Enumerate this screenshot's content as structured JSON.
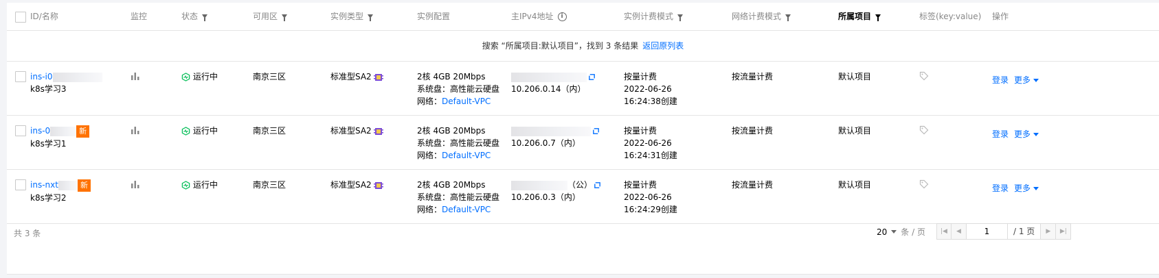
{
  "header": {
    "id_name": "ID/名称",
    "monitor": "监控",
    "status": "状态",
    "zone": "可用区",
    "instance_type": "实例类型",
    "config": "实例配置",
    "ipv4": "主IPv4地址",
    "billing": "实例计费模式",
    "net_billing": "网络计费模式",
    "project": "所属项目",
    "tags": "标签(key:value)",
    "ops": "操作"
  },
  "notice": {
    "text": "搜索 “所属项目:默认项目”，找到 3 条结果",
    "back_link": "返回原列表"
  },
  "rows": [
    {
      "id": "ins-i0",
      "name": "k8s学习3",
      "new_badge": "",
      "status": "运行中",
      "zone": "南京三区",
      "type": "标准型SA2",
      "config_cpu": "2核 4GB 20Mbps",
      "config_disk": "系统盘：高性能云硬盘",
      "config_net_label": "网络：",
      "config_net": "Default-VPC",
      "ip_public_suffix": "",
      "ip_private": "10.206.0.14（内）",
      "billing": "按量计费",
      "created_date": "2022-06-26",
      "created_time": "16:24:38创建",
      "net_billing": "按流量计费",
      "project": "默认项目",
      "login": "登录",
      "more": "更多"
    },
    {
      "id": "ins-0",
      "name": "k8s学习1",
      "new_badge": "新",
      "status": "运行中",
      "zone": "南京三区",
      "type": "标准型SA2",
      "config_cpu": "2核 4GB 20Mbps",
      "config_disk": "系统盘：高性能云硬盘",
      "config_net_label": "网络：",
      "config_net": "Default-VPC",
      "ip_public_suffix": "",
      "ip_private": "10.206.0.7（内）",
      "billing": "按量计费",
      "created_date": "2022-06-26",
      "created_time": "16:24:31创建",
      "net_billing": "按流量计费",
      "project": "默认项目",
      "login": "登录",
      "more": "更多"
    },
    {
      "id": "ins-nxt",
      "name": "k8s学习2",
      "new_badge": "新",
      "status": "运行中",
      "zone": "南京三区",
      "type": "标准型SA2",
      "config_cpu": "2核 4GB 20Mbps",
      "config_disk": "系统盘：高性能云硬盘",
      "config_net_label": "网络：",
      "config_net": "Default-VPC",
      "ip_public_suffix": "（公）",
      "ip_private": "10.206.0.3（内）",
      "billing": "按量计费",
      "created_date": "2022-06-26",
      "created_time": "16:24:29创建",
      "net_billing": "按流量计费",
      "project": "默认项目",
      "login": "登录",
      "more": "更多"
    }
  ],
  "footer": {
    "total": "共 3 条",
    "page_size": "20",
    "per_page_unit": "条 / 页",
    "current_page": "1",
    "total_pages": "/ 1 页"
  },
  "colors": {
    "link": "#006eff",
    "running": "#0abf5b",
    "new_badge": "#ff7200"
  }
}
